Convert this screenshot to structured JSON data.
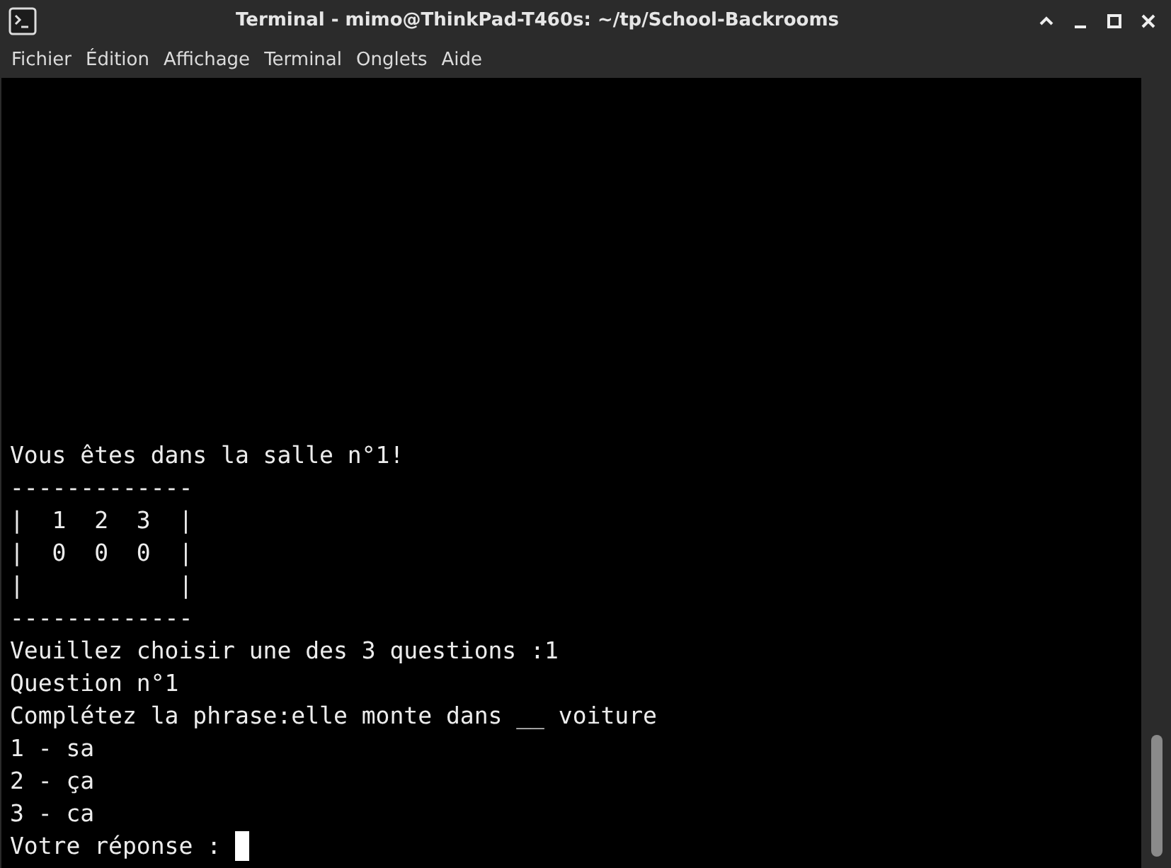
{
  "window": {
    "title": "Terminal - mimo@ThinkPad-T460s: ~/tp/School-Backrooms"
  },
  "menu": [
    "Fichier",
    "Édition",
    "Affichage",
    "Terminal",
    "Onglets",
    "Aide"
  ],
  "terminal": {
    "lines": [
      "Vous êtes dans la salle n°1!",
      "-------------",
      "|  1  2  3  |",
      "|  0  0  0  |",
      "|           |",
      "-------------",
      "Veuillez choisir une des 3 questions :1",
      "Question n°1",
      "Complétez la phrase:elle monte dans __ voiture",
      "1 - sa",
      "2 - ça",
      "3 - ca"
    ],
    "prompt": "Votre réponse : "
  }
}
